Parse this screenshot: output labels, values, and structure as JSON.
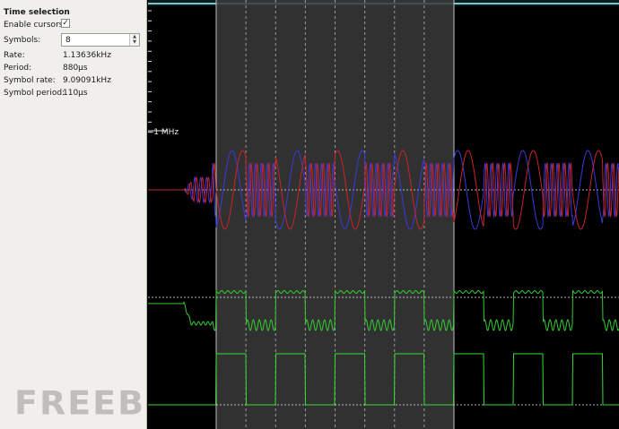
{
  "sidebar": {
    "title": "Time selection",
    "enable_cursors_label": "Enable cursors:",
    "enable_cursors_checked": true,
    "symbols_label": "Symbols:",
    "symbols_value": "8",
    "rate_label": "Rate:",
    "rate_value": "1.13636kHz",
    "period_label": "Period:",
    "period_value": "880µs",
    "symbol_rate_label": "Symbol rate:",
    "symbol_rate_value": "9.09091kHz",
    "symbol_period_label": "Symbol period:",
    "symbol_period_value": "110µs"
  },
  "plot": {
    "freq_label": "-1 MHz",
    "colors": {
      "background": "#000000",
      "selection": "#3a3a3a",
      "i_trace": "#c8232c",
      "q_trace": "#3a3ad6",
      "filtered_trace": "#33cc33",
      "threshold_trace": "#33dd33",
      "cursor": "#bfbfbf"
    }
  },
  "watermark": "FREEBUF"
}
